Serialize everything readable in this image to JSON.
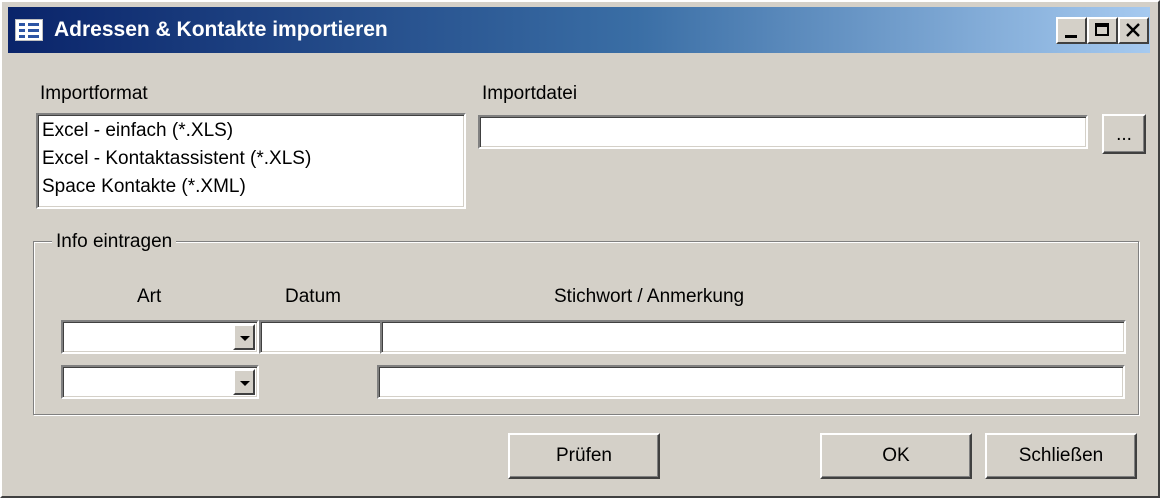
{
  "window": {
    "title": "Adressen & Kontakte importieren",
    "icon": "form-window-icon",
    "controls": [
      "minimize-icon",
      "maximize-icon",
      "close-icon"
    ]
  },
  "import_format": {
    "label": "Importformat",
    "options": [
      "Excel - einfach (*.XLS)",
      "Excel - Kontaktassistent (*.XLS)",
      "Space Kontakte (*.XML)"
    ]
  },
  "import_file": {
    "label": "Importdatei",
    "value": "",
    "browse_label": "..."
  },
  "info": {
    "legend": "Info eintragen",
    "headers": {
      "art": "Art",
      "datum": "Datum",
      "stichwort": "Stichwort / Anmerkung"
    },
    "rows": [
      {
        "art": "",
        "datum": "",
        "stichwort": ""
      },
      {
        "art": "",
        "stichwort": ""
      }
    ]
  },
  "buttons": {
    "check": "Prüfen",
    "ok": "OK",
    "close": "Schließen"
  }
}
